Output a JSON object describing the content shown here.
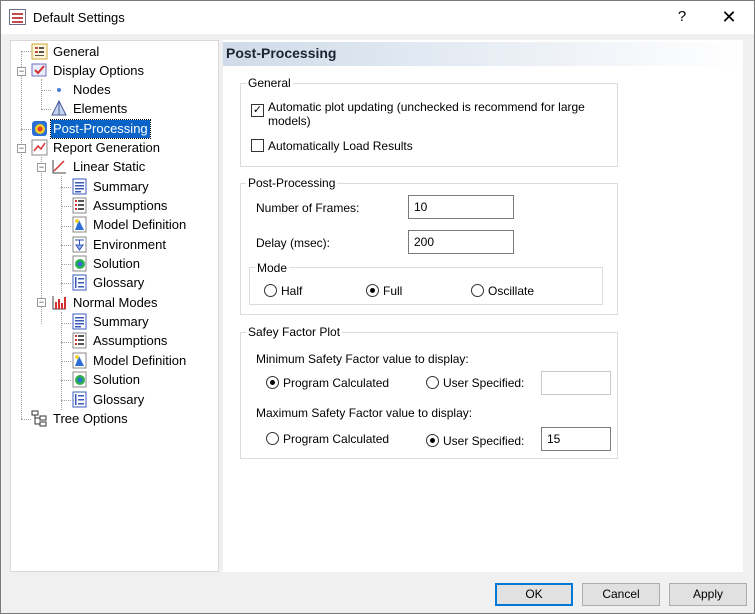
{
  "window": {
    "title": "Default Settings",
    "help_label": "?",
    "close_label": "✕"
  },
  "tree": {
    "items": [
      {
        "label": "General",
        "icon": "general-settings-icon"
      },
      {
        "label": "Display Options",
        "icon": "display-options-icon",
        "expander": "−"
      },
      {
        "label": "Nodes",
        "icon": "node-dot-icon"
      },
      {
        "label": "Elements",
        "icon": "elements-triangle-icon"
      },
      {
        "label": "Post-Processing",
        "icon": "post-processing-icon",
        "selected": true
      },
      {
        "label": "Report Generation",
        "icon": "report-generation-icon",
        "expander": "−"
      },
      {
        "label": "Linear Static",
        "icon": "chart-icon",
        "expander": "−"
      },
      {
        "label": "Summary",
        "icon": "summary-doc-icon"
      },
      {
        "label": "Assumptions",
        "icon": "assumptions-list-icon"
      },
      {
        "label": "Model Definition",
        "icon": "model-definition-icon"
      },
      {
        "label": "Environment",
        "icon": "environment-icon"
      },
      {
        "label": "Solution",
        "icon": "solution-icon"
      },
      {
        "label": "Glossary",
        "icon": "glossary-icon"
      },
      {
        "label": "Normal Modes",
        "icon": "bar-chart-icon",
        "expander": "−"
      },
      {
        "label": "Summary",
        "icon": "summary-doc-icon"
      },
      {
        "label": "Assumptions",
        "icon": "assumptions-list-icon"
      },
      {
        "label": "Model Definition",
        "icon": "model-definition-icon"
      },
      {
        "label": "Solution",
        "icon": "solution-icon"
      },
      {
        "label": "Glossary",
        "icon": "glossary-icon"
      },
      {
        "label": "Tree Options",
        "icon": "tree-options-icon"
      }
    ]
  },
  "panel": {
    "title": "Post-Processing",
    "general": {
      "title": "General",
      "auto_plot_label": "Automatic plot updating (unchecked is recommend for large models)",
      "auto_plot_checked": true,
      "auto_load_label": "Automatically Load Results",
      "auto_load_checked": false
    },
    "post_processing": {
      "title": "Post-Processing",
      "frames_label": "Number of Frames:",
      "frames_value": "10",
      "delay_label": "Delay (msec):",
      "delay_value": "200",
      "mode": {
        "title": "Mode",
        "options": [
          "Half",
          "Full",
          "Oscillate"
        ],
        "selected": "Full"
      }
    },
    "safety": {
      "title": "Safey Factor Plot",
      "min_label": "Minimum Safety Factor value to display:",
      "min_program_label": "Program Calculated",
      "min_user_label": "User Specified:",
      "min_selected": "Program Calculated",
      "min_value": "",
      "max_label": "Maximum Safety Factor value to display:",
      "max_program_label": "Program Calculated",
      "max_user_label": "User Specified:",
      "max_selected": "User Specified",
      "max_value": "15"
    }
  },
  "buttons": {
    "ok": "OK",
    "cancel": "Cancel",
    "apply": "Apply"
  },
  "colors": {
    "selection": "#0a64c8",
    "default_button_border": "#0078d7",
    "header_gradient_start": "#cfdbe9"
  }
}
